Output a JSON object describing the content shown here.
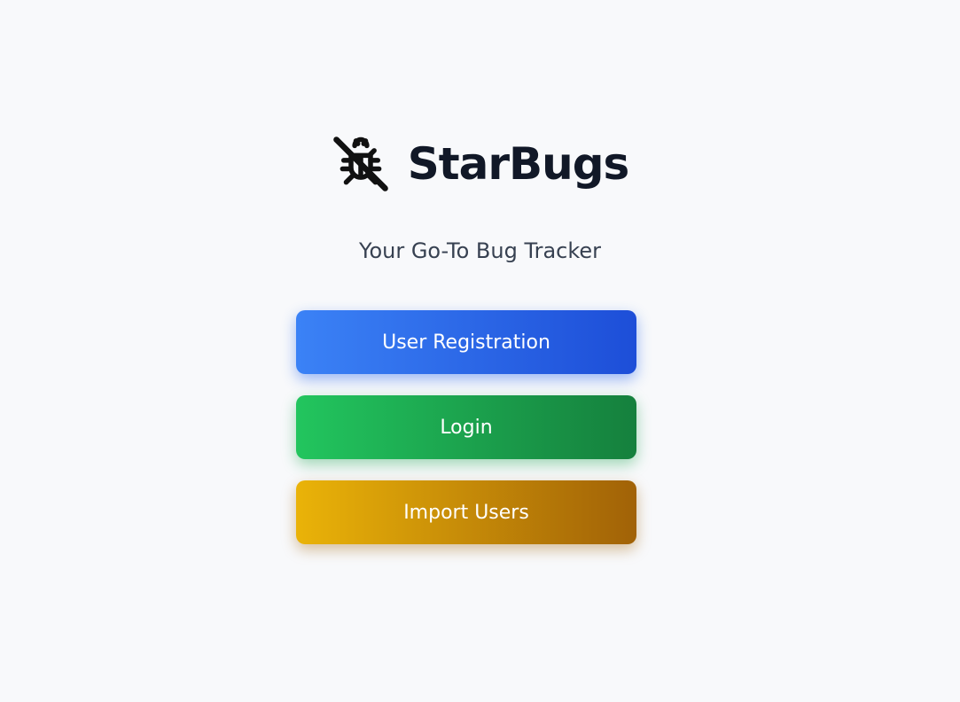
{
  "app": {
    "title": "StarBugs",
    "logo_icon": "bug-off-icon",
    "tagline": "Your Go-To Bug Tracker"
  },
  "actions": {
    "register_label": "User Registration",
    "login_label": "Login",
    "import_label": "Import Users"
  },
  "colors": {
    "background": "#f8f9fb",
    "title": "#111827",
    "tagline": "#374151",
    "register_gradient": [
      "#3b82f6",
      "#1d4ed8"
    ],
    "login_gradient": [
      "#22c55e",
      "#15803d"
    ],
    "import_gradient": [
      "#eab308",
      "#a16207"
    ]
  }
}
